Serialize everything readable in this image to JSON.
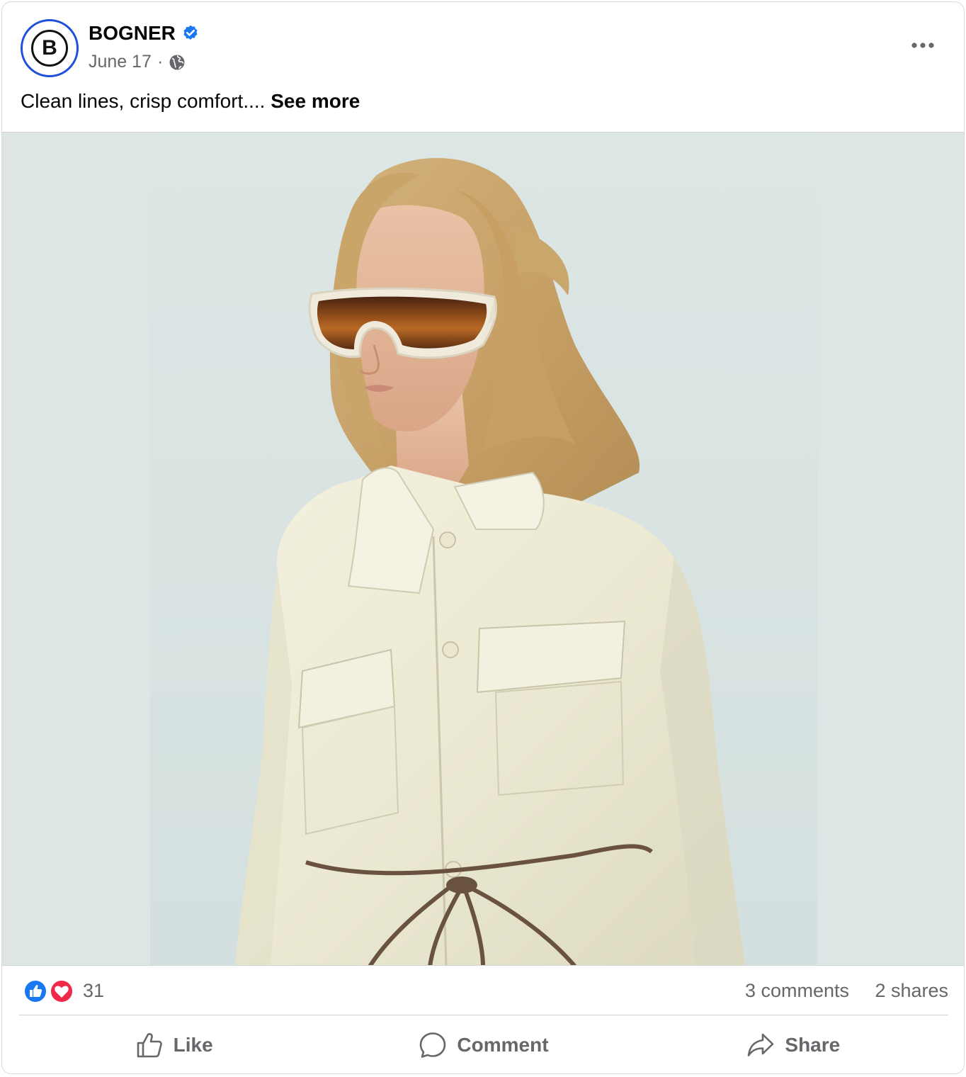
{
  "post": {
    "page_name": "BOGNER",
    "avatar_letter": "B",
    "date": "June 17",
    "separator": "·",
    "caption": "Clean lines, crisp comfort....",
    "see_more": "See more"
  },
  "icons": {
    "verified": "verified-badge-icon",
    "audience": "globe-icon",
    "more": "more-options-icon",
    "reactions": [
      "like-reaction-icon",
      "love-reaction-icon"
    ],
    "like": "thumbs-up-icon",
    "comment": "comment-bubble-icon",
    "share": "share-arrow-icon"
  },
  "stats": {
    "reactions": "31",
    "comments": "3 comments",
    "shares": "2 shares"
  },
  "actions": {
    "like": "Like",
    "comment": "Comment",
    "share": "Share"
  },
  "colors": {
    "verified_blue": "#1877f2",
    "avatar_ring": "#1d4fdc",
    "love_red": "#f02849",
    "secondary_text": "#65676b"
  }
}
